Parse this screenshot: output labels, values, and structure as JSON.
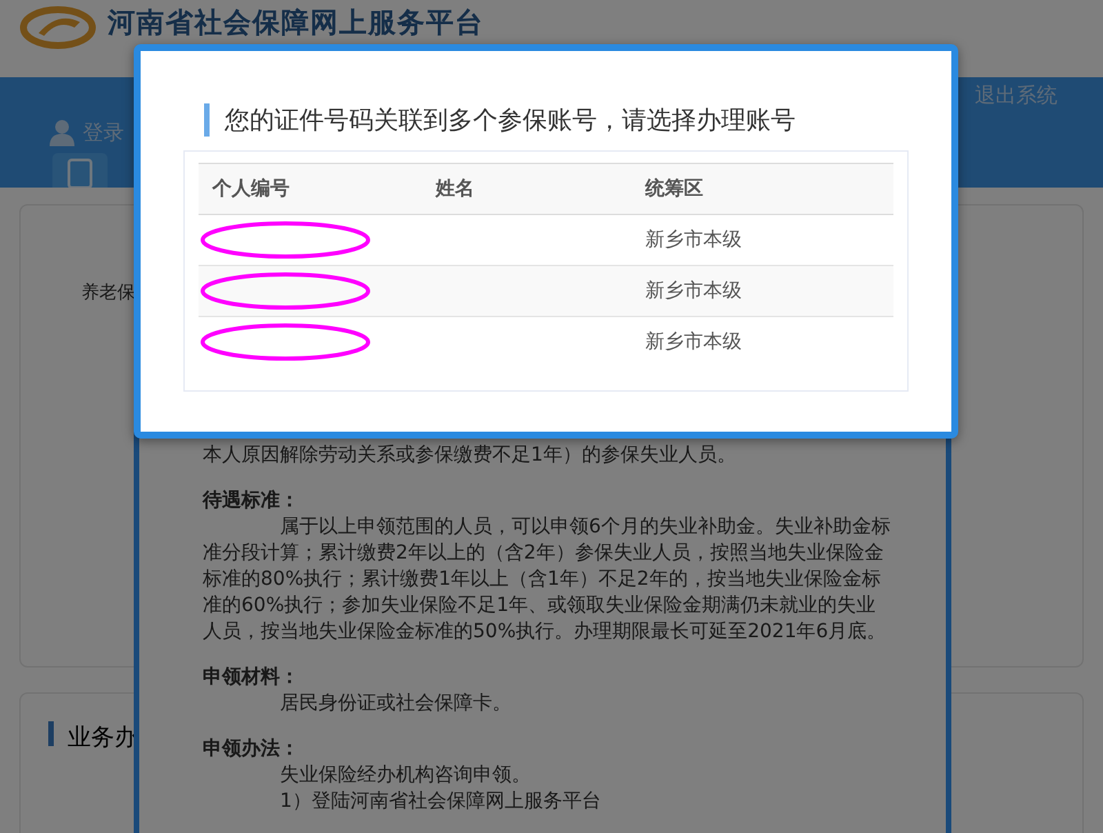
{
  "header": {
    "title": "河南省社会保障网上服务平台"
  },
  "nav": {
    "user_label": "登录",
    "logout": "退出系统"
  },
  "cards": [
    {
      "text": "养老保"
    },
    {
      "title": "业务办"
    }
  ],
  "notice": {
    "intro": "本人原因解除劳动关系或参保缴费不足1年）的参保失业人员。",
    "sections": [
      {
        "heading": "待遇标准：",
        "paragraphs": [
          "属于以上申领范围的人员，可以申领6个月的失业补助金。失业补助金标准分段计算；累计缴费2年以上的（含2年）参保失业人员，按照当地失业保险金标准的80%执行；累计缴费1年以上（含1年）不足2年的，按当地失业保险金标准的60%执行；参加失业保险不足1年、或领取失业保险金期满仍未就业的失业人员，按当地失业保险金标准的50%执行。办理期限最长可延至2021年6月底。"
        ]
      },
      {
        "heading": "申领材料：",
        "paragraphs": [
          "居民身份证或社会保障卡。"
        ]
      },
      {
        "heading": "申领办法：",
        "paragraphs": [
          "失业保险经办机构咨询申领。",
          "1）登陆河南省社会保障网上服务平台"
        ]
      }
    ]
  },
  "dialog": {
    "title": "您的证件号码关联到多个参保账号，请选择办理账号",
    "table": {
      "columns": [
        "个人编号",
        "姓名",
        "统筹区"
      ],
      "rows": [
        {
          "district": "新乡市本级"
        },
        {
          "district": "新乡市本级"
        },
        {
          "district": "新乡市本级"
        }
      ]
    }
  }
}
